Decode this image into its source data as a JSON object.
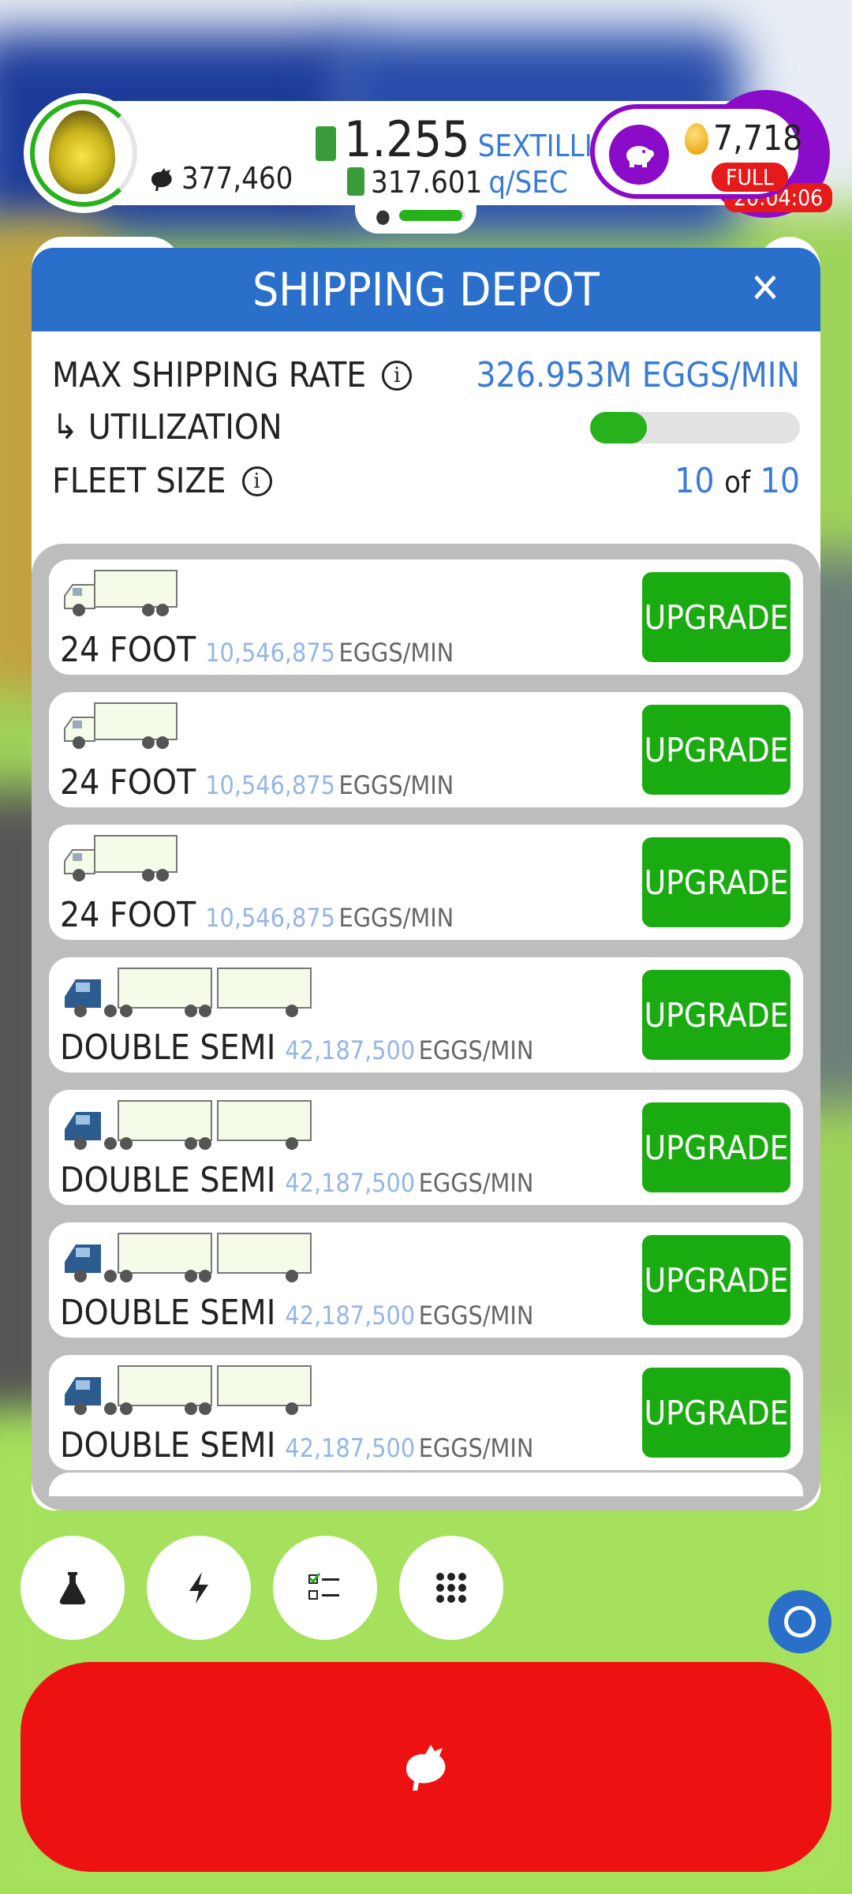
{
  "hud": {
    "chicken_count": "377,460",
    "money_value": "1.255",
    "money_unit": "SEXTILLION",
    "earning_value": "317.601",
    "earning_unit": "q/SEC",
    "golden_eggs": "7,718",
    "silo_status": "FULL",
    "timer": "20:04:06"
  },
  "panel": {
    "title": "SHIPPING DEPOT",
    "close_glyph": "✕",
    "max_rate_label": "MAX SHIPPING RATE",
    "max_rate_value": "326.953M EGGS/MIN",
    "utilization_label": "↳ UTILIZATION",
    "utilization_fraction": 0.27,
    "fleet_label": "FLEET SIZE",
    "fleet_current": "10",
    "fleet_of": "of",
    "fleet_max": "10"
  },
  "vehicles": [
    {
      "name": "24 FOOT",
      "rate": "10,546,875",
      "unit": "EGGS/MIN",
      "kind": "box",
      "button": "UPGRADE"
    },
    {
      "name": "24 FOOT",
      "rate": "10,546,875",
      "unit": "EGGS/MIN",
      "kind": "box",
      "button": "UPGRADE"
    },
    {
      "name": "24 FOOT",
      "rate": "10,546,875",
      "unit": "EGGS/MIN",
      "kind": "box",
      "button": "UPGRADE"
    },
    {
      "name": "DOUBLE SEMI",
      "rate": "42,187,500",
      "unit": "EGGS/MIN",
      "kind": "semi",
      "button": "UPGRADE"
    },
    {
      "name": "DOUBLE SEMI",
      "rate": "42,187,500",
      "unit": "EGGS/MIN",
      "kind": "semi",
      "button": "UPGRADE"
    },
    {
      "name": "DOUBLE SEMI",
      "rate": "42,187,500",
      "unit": "EGGS/MIN",
      "kind": "semi",
      "button": "UPGRADE"
    },
    {
      "name": "DOUBLE SEMI",
      "rate": "42,187,500",
      "unit": "EGGS/MIN",
      "kind": "semi",
      "button": "UPGRADE"
    }
  ],
  "bottom_bar": {
    "icons": [
      "flask-icon",
      "lightning-icon",
      "checklist-icon",
      "grid-menu-icon"
    ]
  },
  "colors": {
    "header_blue": "#2a6fc9",
    "upgrade_green": "#1aab10",
    "hatch_red": "#ee1111",
    "silo_purple": "#8a0cc9"
  }
}
